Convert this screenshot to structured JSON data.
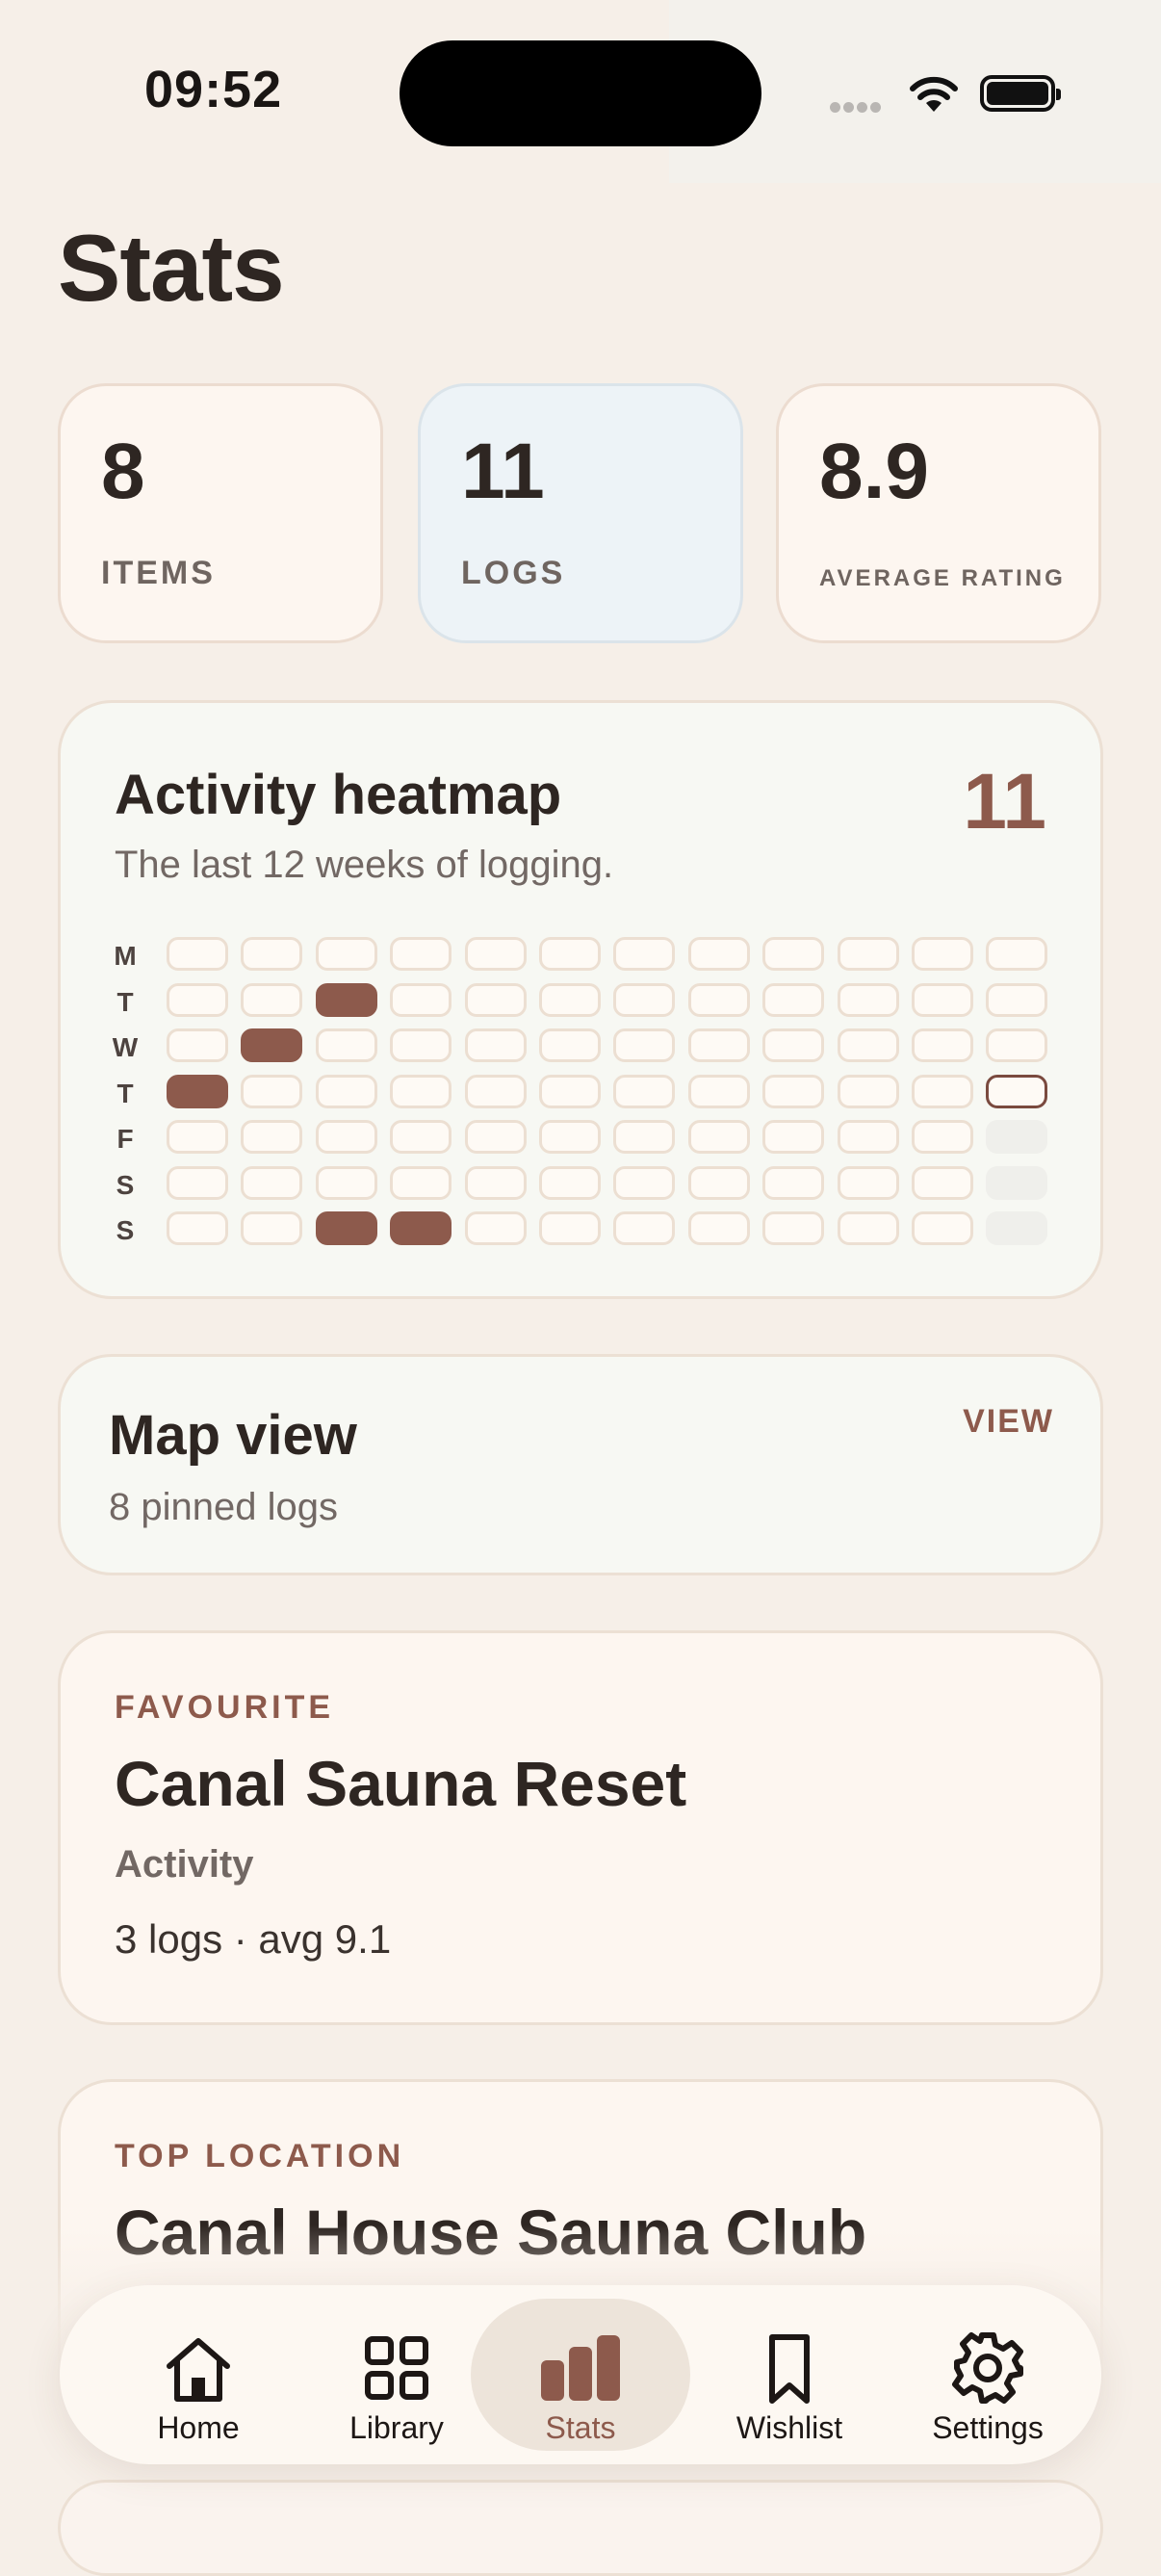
{
  "status_bar": {
    "time": "09:52"
  },
  "page": {
    "title": "Stats"
  },
  "stats": [
    {
      "value": "8",
      "label": "ITEMS"
    },
    {
      "value": "11",
      "label": "LOGS"
    },
    {
      "value": "8.9",
      "label": "AVERAGE RATING"
    }
  ],
  "heatmap": {
    "title": "Activity heatmap",
    "subtitle": "The last 12 weeks of logging.",
    "count": "11",
    "day_labels": [
      "M",
      "T",
      "W",
      "T",
      "F",
      "S",
      "S"
    ],
    "weeks": 12,
    "filled_cells": [
      {
        "day": 1,
        "week": 2
      },
      {
        "day": 2,
        "week": 1
      },
      {
        "day": 3,
        "week": 0
      },
      {
        "day": 6,
        "week": 2
      },
      {
        "day": 6,
        "week": 3
      }
    ],
    "today": {
      "day": 3,
      "week": 11
    },
    "future_cells": [
      {
        "day": 4,
        "week": 11
      },
      {
        "day": 5,
        "week": 11
      },
      {
        "day": 6,
        "week": 11
      }
    ],
    "colors": {
      "filled": "#8d5a4c",
      "empty": "#fefaf5",
      "future": "#efefeb"
    }
  },
  "map_view": {
    "title": "Map view",
    "subtitle": "8 pinned logs",
    "action": "VIEW"
  },
  "favourite": {
    "eyebrow": "FAVOURITE",
    "title": "Canal Sauna Reset",
    "category": "Activity",
    "meta": "3 logs · avg 9.1"
  },
  "top_location": {
    "eyebrow": "TOP LOCATION",
    "title": "Canal House Sauna Club"
  },
  "tab_bar": {
    "active": "Stats",
    "tabs": [
      {
        "label": "Home",
        "icon": "home-icon"
      },
      {
        "label": "Library",
        "icon": "grid-icon"
      },
      {
        "label": "Stats",
        "icon": "bar-chart-icon"
      },
      {
        "label": "Wishlist",
        "icon": "bookmark-icon"
      },
      {
        "label": "Settings",
        "icon": "gear-icon"
      }
    ]
  },
  "colors": {
    "accent": "#8d5a4c",
    "background": "#f6efe8",
    "text": "#2e2622"
  }
}
